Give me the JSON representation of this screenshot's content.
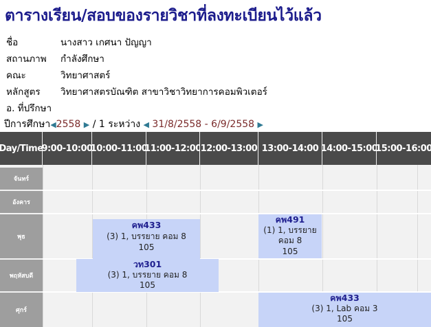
{
  "title": "ตารางเรียน/สอบของรายวิชาที่ลงทะเบียนไว้แล้ว",
  "student": {
    "name_label": "ชื่อ",
    "name": "นางสาว เกศนา ปัญญา",
    "status_label": "สถานภาพ",
    "status": "กำลังศึกษา",
    "faculty_label": "คณะ",
    "faculty": "วิทยาศาสตร์",
    "program_label": "หลักสูตร",
    "program": "วิทยาศาสตรบัณฑิต สาขาวิชาวิทยาการคอมพิวเตอร์",
    "advisor_label": "อ. ที่ปรึกษา",
    "advisor": ""
  },
  "term": {
    "year_label": "ปีการศึกษา",
    "year": "2558",
    "semester": "/ 1",
    "range_label": "ระหว่าง",
    "date_range": "31/8/2558 - 6/9/2558"
  },
  "icons": {
    "prev": "triangle-left-icon",
    "next": "triangle-right-icon"
  },
  "colors": {
    "title": "#1c1c8c",
    "header_bg": "#4a4a4a",
    "day_bg": "#9e9e9e",
    "course_bg": "#c7d4f8",
    "course_code": "#1f1f8f"
  },
  "schedule": {
    "header": [
      "Day/Time",
      "9:00-10:00",
      "10:00-11:00",
      "11:00-12:00",
      "12:00-13:00",
      "13:00-14:00",
      "14:00-15:00",
      "15:00-16:00"
    ],
    "days": [
      "จันทร์",
      "อังคาร",
      "พุธ",
      "พฤหัสบดี",
      "ศุกร์"
    ],
    "courses": [
      {
        "code": "คพ433",
        "desc": "(3) 1, บรรยาย คอม 8",
        "room": "105"
      },
      {
        "code": "คพ491",
        "desc": "(1) 1, บรรยาย คอม 8",
        "room": "105"
      },
      {
        "code": "วท301",
        "desc": "(3) 1, บรรยาย คอม 8",
        "room": "105"
      },
      {
        "code": "คพ433",
        "desc": "(3) 1, Lab คอม 3",
        "room": "105"
      }
    ]
  }
}
